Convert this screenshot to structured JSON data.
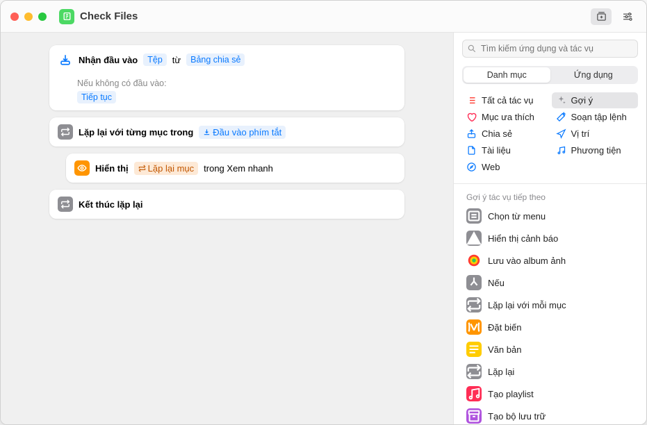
{
  "title": "Check Files",
  "actions": {
    "input": {
      "label": "Nhận đầu vào",
      "token1": "Tệp",
      "mid": "từ",
      "token2": "Bảng chia sẻ",
      "fallback_label": "Nếu không có đầu vào:",
      "fallback_token": "Tiếp tục"
    },
    "repeat": {
      "label": "Lặp lại với từng mục trong",
      "token": "Đầu vào phím tắt"
    },
    "show": {
      "label": "Hiển thị",
      "token": "Lặp lại mục",
      "tail": "trong Xem nhanh"
    },
    "end": {
      "label": "Kết thúc lặp lại"
    }
  },
  "sidebar": {
    "search_placeholder": "Tìm kiếm ứng dụng và tác vụ",
    "seg": {
      "a": "Danh mục",
      "b": "Ứng dụng"
    },
    "cats": [
      {
        "label": "Tất cả tác vụ",
        "color": "#ff3b30",
        "icon": "list"
      },
      {
        "label": "Gợi ý",
        "color": "#8e8e93",
        "icon": "sparkle",
        "selected": true
      },
      {
        "label": "Mục ưa thích",
        "color": "#ff2d55",
        "icon": "heart"
      },
      {
        "label": "Soạn tập lệnh",
        "color": "#0a7aff",
        "icon": "wand"
      },
      {
        "label": "Chia sẻ",
        "color": "#0a7aff",
        "icon": "share"
      },
      {
        "label": "Vị trí",
        "color": "#0a7aff",
        "icon": "nav"
      },
      {
        "label": "Tài liệu",
        "color": "#0a7aff",
        "icon": "doc"
      },
      {
        "label": "Phương tiện",
        "color": "#0a7aff",
        "icon": "music"
      },
      {
        "label": "Web",
        "color": "#0a7aff",
        "icon": "safari"
      }
    ],
    "suggest_header": "Gợi ý tác vụ tiếp theo",
    "suggestions": [
      {
        "label": "Chọn từ menu",
        "color": "#8e8e93",
        "icon": "menu"
      },
      {
        "label": "Hiển thị cảnh báo",
        "color": "#8e8e93",
        "icon": "alert"
      },
      {
        "label": "Lưu vào album ảnh",
        "color": "multi",
        "icon": "photo"
      },
      {
        "label": "Nếu",
        "color": "#8e8e93",
        "icon": "branch"
      },
      {
        "label": "Lặp lại với mỗi mục",
        "color": "#8e8e93",
        "icon": "repeat"
      },
      {
        "label": "Đặt biến",
        "color": "#ff9500",
        "icon": "var"
      },
      {
        "label": "Văn bản",
        "color": "#ffcc00",
        "icon": "text"
      },
      {
        "label": "Lặp lại",
        "color": "#8e8e93",
        "icon": "repeat"
      },
      {
        "label": "Tạo playlist",
        "color": "#ff2d55",
        "icon": "music"
      },
      {
        "label": "Tạo bộ lưu trữ",
        "color": "#af52de",
        "icon": "archive"
      }
    ]
  }
}
